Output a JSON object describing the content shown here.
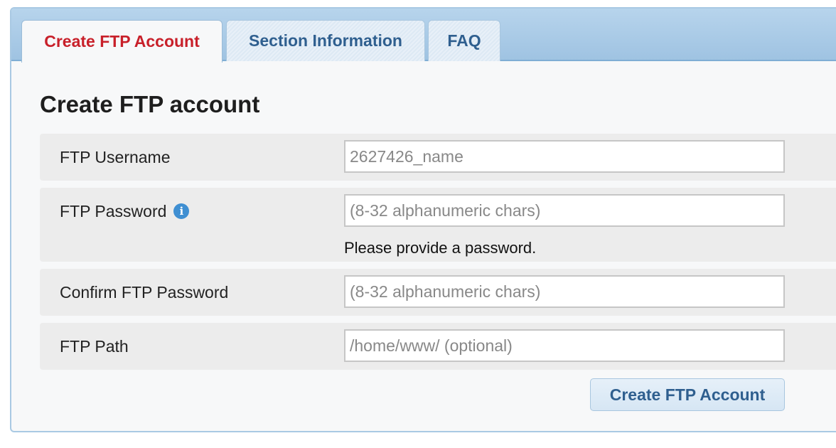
{
  "tabs": {
    "create": "Create FTP Account",
    "section": "Section Information",
    "faq": "FAQ"
  },
  "form": {
    "title": "Create FTP account",
    "username": {
      "label": "FTP Username",
      "placeholder": "2627426_name"
    },
    "password": {
      "label": "FTP Password",
      "placeholder": "(8-32 alphanumeric chars)",
      "error": "Please provide a password."
    },
    "confirm": {
      "label": "Confirm FTP Password",
      "placeholder": "(8-32 alphanumeric chars)"
    },
    "path": {
      "label": "FTP Path",
      "placeholder": "/home/www/ (optional)"
    },
    "submit_label": "Create FTP Account"
  },
  "colors": {
    "active_tab_text": "#c8202a",
    "tab_text": "#2f5f8f",
    "info_icon": "#3f8fd2"
  },
  "icons": {
    "password_info": "info-icon"
  }
}
